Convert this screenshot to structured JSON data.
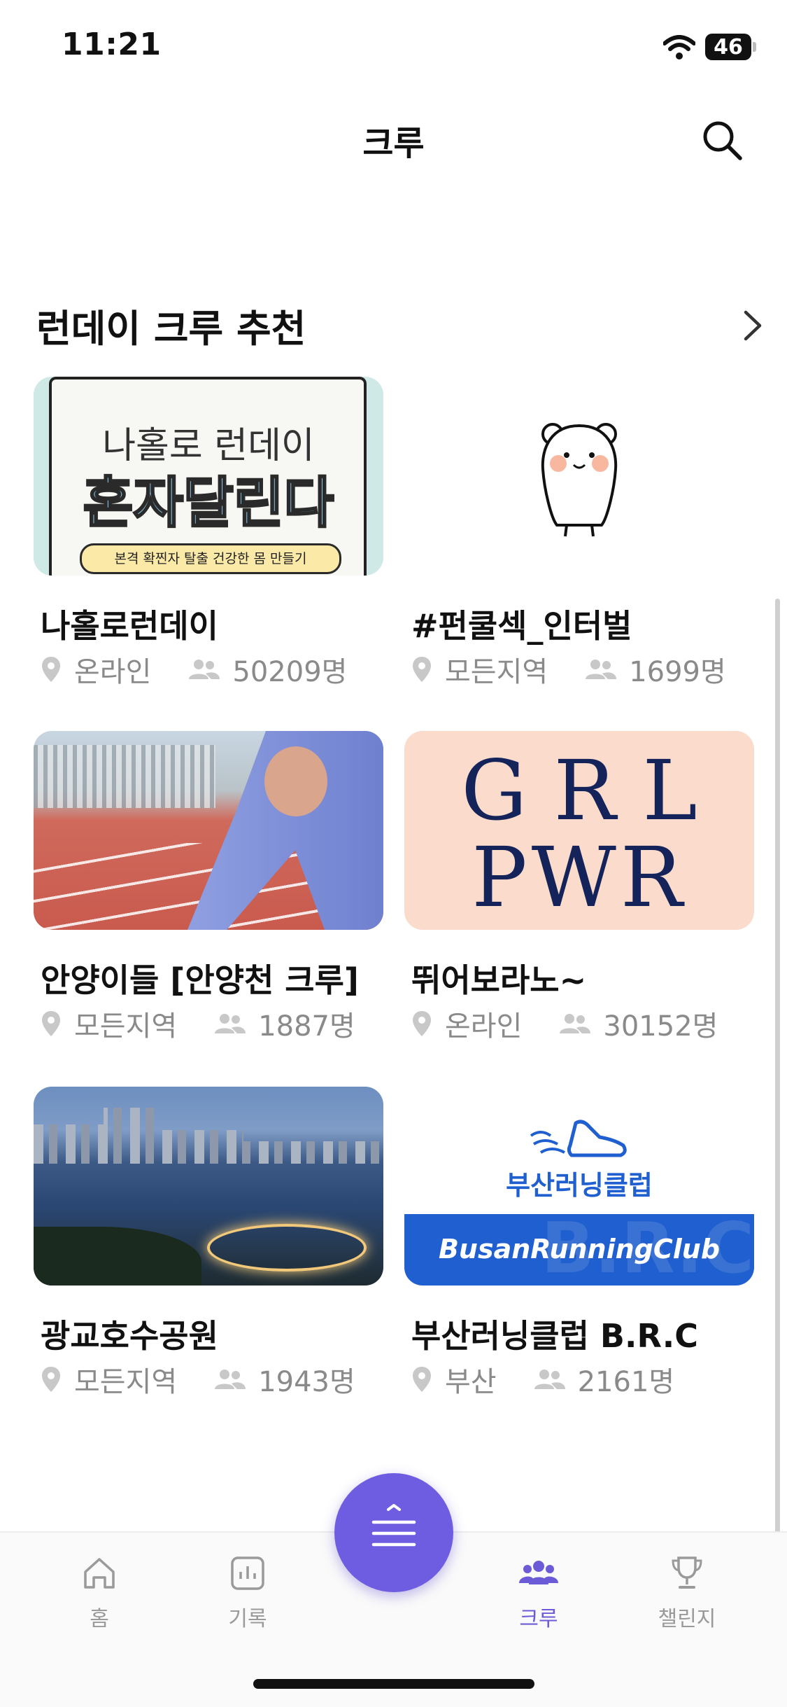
{
  "status_bar": {
    "time": "11:21",
    "battery": "46"
  },
  "header": {
    "title": "크루"
  },
  "section": {
    "title": "런데이 크루 추천"
  },
  "cards": [
    {
      "name": "나홀로런데이",
      "region": "온라인",
      "members": "50209명",
      "thumb_text": {
        "line1": "나홀로 런데이",
        "line2": "혼자달린다",
        "banner": "본격 확찐자 탈출 건강한 몸 만들기"
      }
    },
    {
      "name": "#펀쿨섹_인터벌",
      "region": "모든지역",
      "members": "1699명"
    },
    {
      "name": "안양이들 [안양천 크루]",
      "region": "모든지역",
      "members": "1887명"
    },
    {
      "name": "뛰어보라노~",
      "region": "온라인",
      "members": "30152명",
      "thumb_text": {
        "line1": "GRL",
        "line2": "PWR"
      }
    },
    {
      "name": "광교호수공원",
      "region": "모든지역",
      "members": "1943명"
    },
    {
      "name": "부산러닝클럽 B.R.C",
      "region": "부산",
      "members": "2161명",
      "thumb_text": {
        "line1": "부산러닝클럽",
        "banner": "BusanRunningClub",
        "watermark": "B.R.C"
      }
    }
  ],
  "tabs": [
    {
      "label": "홈",
      "icon": "home-icon"
    },
    {
      "label": "기록",
      "icon": "chart-icon"
    },
    {
      "label": "크루",
      "icon": "people-icon"
    },
    {
      "label": "챌린지",
      "icon": "trophy-icon"
    }
  ],
  "colors": {
    "accent": "#6E5DE0",
    "meta_text": "#8a8a8a"
  }
}
